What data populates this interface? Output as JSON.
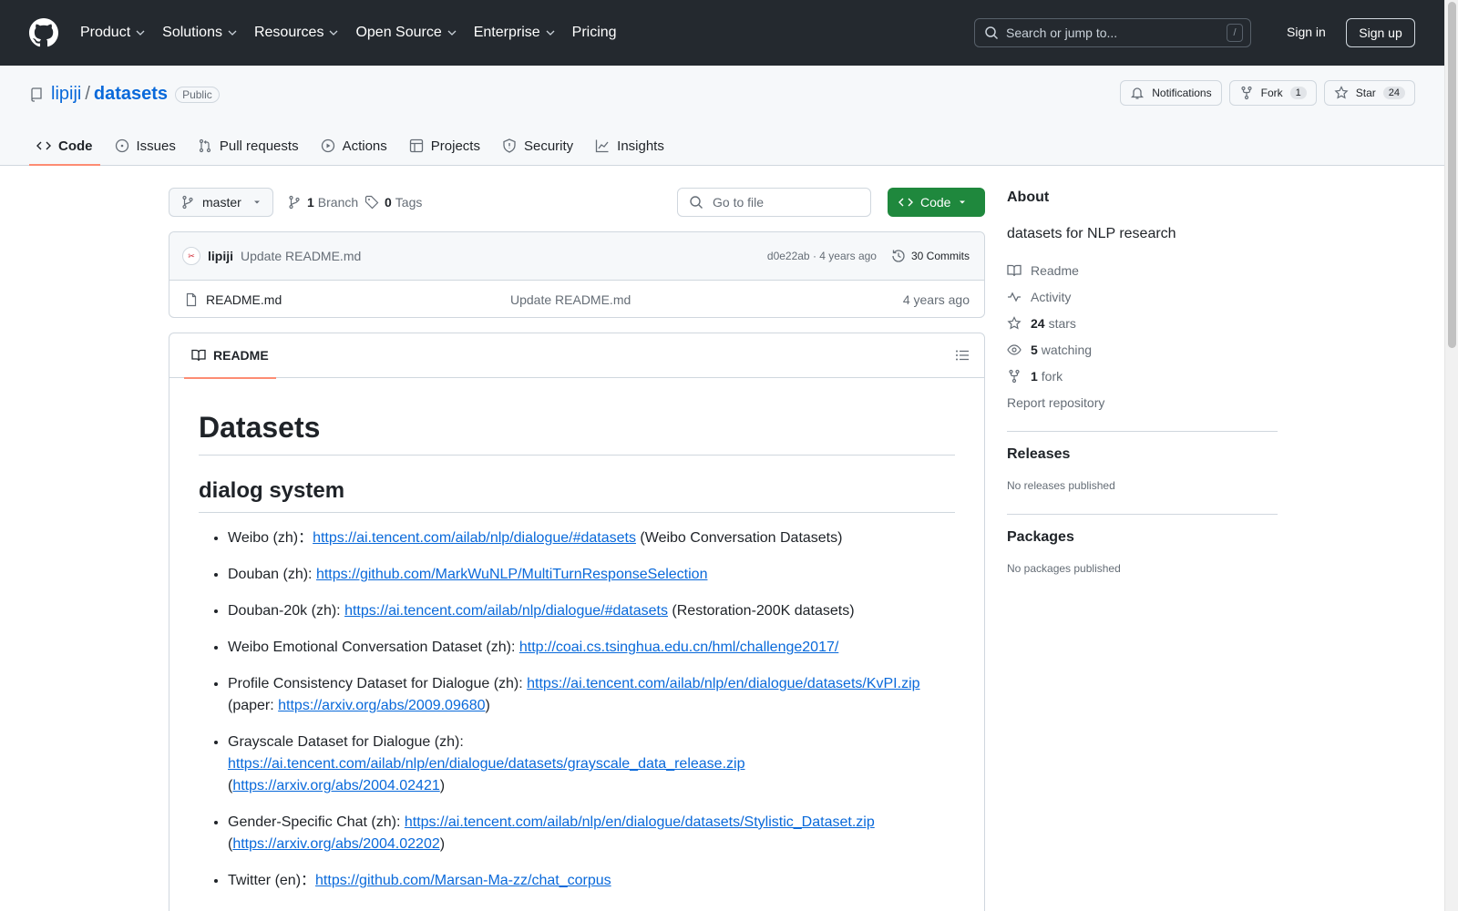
{
  "header": {
    "nav": [
      "Product",
      "Solutions",
      "Resources",
      "Open Source",
      "Enterprise",
      "Pricing"
    ],
    "search_placeholder": "Search or jump to...",
    "search_key": "/",
    "sign_in": "Sign in",
    "sign_up": "Sign up"
  },
  "repo": {
    "owner": "lipiji",
    "separator": "/",
    "name": "datasets",
    "visibility": "Public",
    "notifications_label": "Notifications",
    "fork_label": "Fork",
    "fork_count": "1",
    "star_label": "Star",
    "star_count": "24"
  },
  "tabs": [
    "Code",
    "Issues",
    "Pull requests",
    "Actions",
    "Projects",
    "Security",
    "Insights"
  ],
  "toolbar": {
    "branch": "master",
    "branch_count": "1",
    "branch_label": "Branch",
    "tag_count": "0",
    "tag_label": "Tags",
    "go_to_file": "Go to file",
    "code_button": "Code"
  },
  "commit": {
    "author": "lipiji",
    "message": "Update README.md",
    "meta": "d0e22ab · 4 years ago",
    "commits": "30 Commits"
  },
  "files": [
    {
      "name": "README.md",
      "message": "Update README.md",
      "age": "4 years ago"
    }
  ],
  "readme": {
    "tab_label": "README",
    "h1": "Datasets",
    "h2": "dialog system",
    "items": [
      {
        "pre": "Weibo (zh)：",
        "link": "https://ai.tencent.com/ailab/nlp/dialogue/#datasets",
        "post": " (Weibo Conversation Datasets)"
      },
      {
        "pre": "Douban (zh): ",
        "link": "https://github.com/MarkWuNLP/MultiTurnResponseSelection",
        "post": ""
      },
      {
        "pre": "Douban-20k (zh): ",
        "link": "https://ai.tencent.com/ailab/nlp/dialogue/#datasets",
        "post": " (Restoration-200K datasets)"
      },
      {
        "pre": "Weibo Emotional Conversation Dataset (zh): ",
        "link": "http://coai.cs.tsinghua.edu.cn/hml/challenge2017/",
        "post": ""
      },
      {
        "pre": "Profile Consistency Dataset for Dialogue (zh): ",
        "link": "https://ai.tencent.com/ailab/nlp/en/dialogue/datasets/KvPI.zip",
        "mid": " (paper: ",
        "link2": "https://arxiv.org/abs/2009.09680",
        "post": ")"
      },
      {
        "pre": "Grayscale Dataset for Dialogue (zh): ",
        "link": "https://ai.tencent.com/ailab/nlp/en/dialogue/datasets/grayscale_data_release.zip",
        "mid": " (",
        "link2": "https://arxiv.org/abs/2004.02421",
        "post": ")"
      },
      {
        "pre": "Gender-Specific Chat (zh): ",
        "link": "https://ai.tencent.com/ailab/nlp/en/dialogue/datasets/Stylistic_Dataset.zip",
        "mid": " (",
        "link2": "https://arxiv.org/abs/2004.02202",
        "post": ")"
      },
      {
        "pre": "Twitter (en)：",
        "link": "https://github.com/Marsan-Ma-zz/chat_corpus",
        "post": ""
      }
    ]
  },
  "about": {
    "title": "About",
    "description": "datasets for NLP research",
    "readme": "Readme",
    "activity": "Activity",
    "stars_count": "24",
    "stars_label": "stars",
    "watching_count": "5",
    "watching_label": "watching",
    "fork_count": "1",
    "fork_label": "fork",
    "report": "Report repository"
  },
  "releases": {
    "title": "Releases",
    "note": "No releases published"
  },
  "packages": {
    "title": "Packages",
    "note": "No packages published"
  }
}
